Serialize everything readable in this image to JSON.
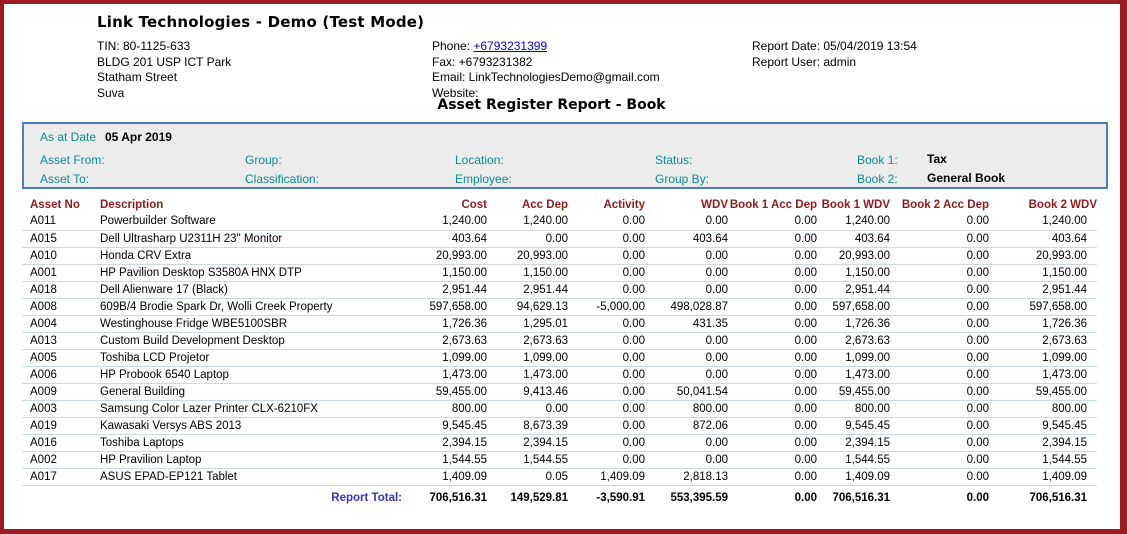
{
  "colors": {
    "frame_maroon": "#9d1c22",
    "table_header_text": "#8e1b1b",
    "filter_label_teal": "#0d8b8b",
    "filter_border_blue": "#4d7ebd",
    "filter_background": "#ececec",
    "phone_link_blue": "#0000dd",
    "report_total_blue": "#3333cc",
    "row_separator": "#c9d9ea"
  },
  "header": {
    "company_name": "Link Technologies - Demo (Test Mode)",
    "address_lines": [
      "TIN: 80-1125-633",
      "BLDG 201 USP ICT Park",
      "Statham Street",
      "Suva"
    ],
    "contact": {
      "phone_label": "Phone: ",
      "phone_number": "+6793231399",
      "fax": "Fax: +6793231382",
      "email": "Email: LinkTechnologiesDemo@gmail.com",
      "website": "Website:"
    },
    "meta": {
      "report_date": "Report Date: 05/04/2019 13:54",
      "report_user": "Report User: admin"
    },
    "title": "Asset Register Report - Book"
  },
  "filters": {
    "as_at_date_label": "As at Date",
    "as_at_date_value": "05 Apr 2019",
    "row2": {
      "asset_from": "Asset From:",
      "group": "Group:",
      "location": "Location:",
      "status": "Status:",
      "book1_label": "Book 1:",
      "book1_value": "Tax"
    },
    "row3": {
      "asset_to": "Asset To:",
      "classification": "Classification:",
      "employee": "Employee:",
      "group_by": "Group By:",
      "book2_label": "Book 2:",
      "book2_value": "General Book"
    }
  },
  "table": {
    "columns": [
      "Asset No",
      "Description",
      "Cost",
      "Acc Dep",
      "Activity",
      "WDV",
      "Book 1 Acc Dep",
      "Book 1 WDV",
      "Book 2 Acc Dep",
      "Book 2 WDV"
    ],
    "rows": [
      [
        "A011",
        "Powerbuilder Software",
        "1,240.00",
        "1,240.00",
        "0.00",
        "0.00",
        "0.00",
        "1,240.00",
        "0.00",
        "1,240.00"
      ],
      [
        "A015",
        "Dell Ultrasharp U2311H 23\" Monitor",
        "403.64",
        "0.00",
        "0.00",
        "403.64",
        "0.00",
        "403.64",
        "0.00",
        "403.64"
      ],
      [
        "A010",
        "Honda CRV Extra",
        "20,993.00",
        "20,993.00",
        "0.00",
        "0.00",
        "0.00",
        "20,993.00",
        "0.00",
        "20,993.00"
      ],
      [
        "A001",
        "HP Pavilion Desktop S3580A HNX DTP",
        "1,150.00",
        "1,150.00",
        "0.00",
        "0.00",
        "0.00",
        "1,150.00",
        "0.00",
        "1,150.00"
      ],
      [
        "A018",
        "Dell Alienware 17 (Black)",
        "2,951.44",
        "2,951.44",
        "0.00",
        "0.00",
        "0.00",
        "2,951.44",
        "0.00",
        "2,951.44"
      ],
      [
        "A008",
        "609B/4 Brodie Spark Dr, Wolli Creek Property",
        "597,658.00",
        "94,629.13",
        "-5,000.00",
        "498,028.87",
        "0.00",
        "597,658.00",
        "0.00",
        "597,658.00"
      ],
      [
        "A004",
        "Westinghouse Fridge WBE5100SBR",
        "1,726.36",
        "1,295.01",
        "0.00",
        "431.35",
        "0.00",
        "1,726.36",
        "0.00",
        "1,726.36"
      ],
      [
        "A013",
        "Custom Build Development Desktop",
        "2,673.63",
        "2,673.63",
        "0.00",
        "0.00",
        "0.00",
        "2,673.63",
        "0.00",
        "2,673.63"
      ],
      [
        "A005",
        "Toshiba LCD Projetor",
        "1,099.00",
        "1,099.00",
        "0.00",
        "0.00",
        "0.00",
        "1,099.00",
        "0.00",
        "1,099.00"
      ],
      [
        "A006",
        "HP Probook 6540 Laptop",
        "1,473.00",
        "1,473.00",
        "0.00",
        "0.00",
        "0.00",
        "1,473.00",
        "0.00",
        "1,473.00"
      ],
      [
        "A009",
        "General Building",
        "59,455.00",
        "9,413.46",
        "0.00",
        "50,041.54",
        "0.00",
        "59,455.00",
        "0.00",
        "59,455.00"
      ],
      [
        "A003",
        "Samsung Color Lazer Printer CLX-6210FX",
        "800.00",
        "0.00",
        "0.00",
        "800.00",
        "0.00",
        "800.00",
        "0.00",
        "800.00"
      ],
      [
        "A019",
        "Kawasaki Versys ABS 2013",
        "9,545.45",
        "8,673.39",
        "0.00",
        "872.06",
        "0.00",
        "9,545.45",
        "0.00",
        "9,545.45"
      ],
      [
        "A016",
        "Toshiba Laptops",
        "2,394.15",
        "2,394.15",
        "0.00",
        "0.00",
        "0.00",
        "2,394.15",
        "0.00",
        "2,394.15"
      ],
      [
        "A002",
        "HP Pravilion Laptop",
        "1,544.55",
        "1,544.55",
        "0.00",
        "0.00",
        "0.00",
        "1,544.55",
        "0.00",
        "1,544.55"
      ],
      [
        "A017",
        "ASUS EPAD-EP121 Tablet",
        "1,409.09",
        "0.05",
        "1,409.09",
        "2,818.13",
        "0.00",
        "1,409.09",
        "0.00",
        "1,409.09"
      ]
    ],
    "total": {
      "label": "Report Total:",
      "values": [
        "706,516.31",
        "149,529.81",
        "-3,590.91",
        "553,395.59",
        "0.00",
        "706,516.31",
        "0.00",
        "706,516.31"
      ]
    }
  }
}
